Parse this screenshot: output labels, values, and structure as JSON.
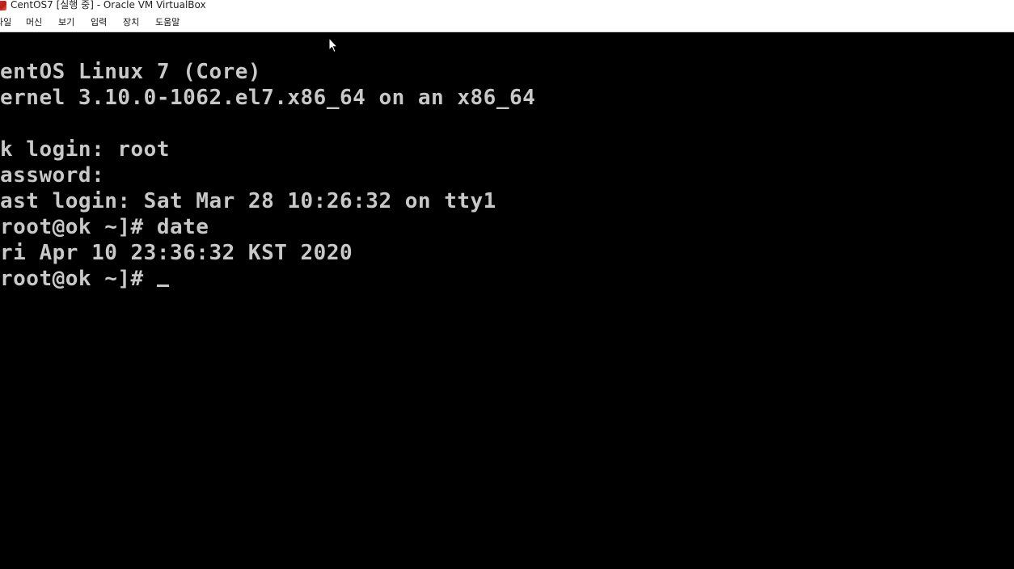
{
  "window": {
    "title": "CentOS7 [실행 중] - Oracle VM VirtualBox"
  },
  "menu": {
    "items": [
      {
        "label": "파일"
      },
      {
        "label": "머신"
      },
      {
        "label": "보기"
      },
      {
        "label": "입력"
      },
      {
        "label": "장치"
      },
      {
        "label": "도움말"
      }
    ]
  },
  "console": {
    "lines": [
      "entOS Linux 7 (Core)",
      "ernel 3.10.0-1062.el7.x86_64 on an x86_64",
      "",
      "k login: root",
      "assword:",
      "ast login: Sat Mar 28 10:26:32 on tty1",
      "root@ok ~]# date",
      "ri Apr 10 23:36:32 KST 2020",
      "root@ok ~]# "
    ]
  },
  "colors": {
    "console_bg": "#000000",
    "console_fg": "#c8c8c8",
    "chrome_bg": "#ffffff"
  },
  "icons": {
    "app": "virtualbox-app-icon",
    "pointer": "mouse-pointer-icon"
  }
}
